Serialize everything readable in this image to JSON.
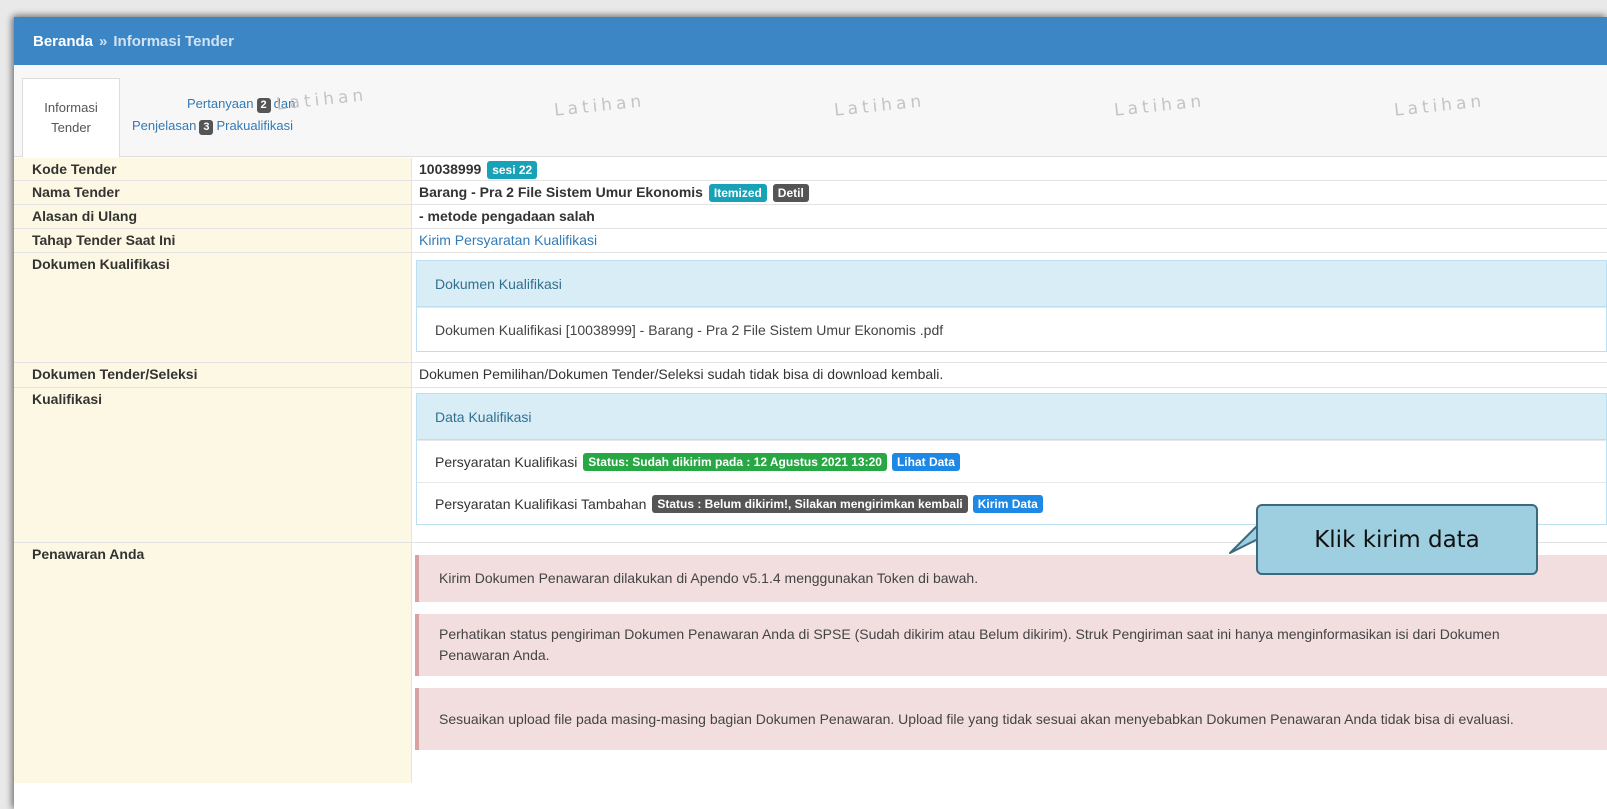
{
  "breadcrumb": {
    "home": "Beranda",
    "separator": "»",
    "current": "Informasi Tender"
  },
  "tabs": {
    "active": {
      "line1": "Informasi",
      "line2": "Tender"
    },
    "second": {
      "part1": "Pertanyaan",
      "badge1": "2",
      "part2": "dan",
      "part3": "Penjelasan",
      "badge2": "3",
      "part4": "Prakualifikasi"
    }
  },
  "watermark": "Latihan",
  "fields": {
    "kode": {
      "label": "Kode Tender",
      "value": "10038999",
      "badge": "sesi 22"
    },
    "nama": {
      "label": "Nama Tender",
      "value": "Barang - Pra 2 File Sistem Umur Ekonomis",
      "badge1": "Itemized",
      "badge2": "Detil"
    },
    "alasan": {
      "label": "Alasan di Ulang",
      "value": "- metode pengadaan salah"
    },
    "tahap": {
      "label": "Tahap Tender Saat Ini",
      "value": "Kirim Persyaratan Kualifikasi"
    },
    "dokumen_kualifikasi": {
      "label": "Dokumen Kualifikasi",
      "panel_title": "Dokumen Kualifikasi",
      "file": "Dokumen Kualifikasi [10038999] - Barang - Pra 2 File Sistem Umur Ekonomis .pdf"
    },
    "dokumen_tender": {
      "label": "Dokumen Tender/Seleksi",
      "value": "Dokumen Pemilihan/Dokumen Tender/Seleksi sudah tidak bisa di download kembali."
    },
    "kualifikasi": {
      "label": "Kualifikasi",
      "panel_title": "Data Kualifikasi",
      "row1": {
        "text": "Persyaratan Kualifikasi",
        "status": "Status: Sudah dikirim pada : 12 Agustus 2021 13:20",
        "action": "Lihat Data"
      },
      "row2": {
        "text": "Persyaratan Kualifikasi Tambahan",
        "status": "Status : Belum dikirim!, Silakan mengirimkan kembali",
        "action": "Kirim Data"
      }
    },
    "penawaran": {
      "label": "Penawaran Anda",
      "alerts": [
        "Kirim Dokumen Penawaran dilakukan di Apendo v5.1.4 menggunakan Token di bawah.",
        "Perhatikan status pengiriman Dokumen Penawaran Anda di SPSE (Sudah dikirim atau Belum dikirim). Struk Pengiriman saat ini hanya menginformasikan isi dari Dokumen Penawaran Anda.",
        "Sesuaikan upload file pada masing-masing bagian Dokumen Penawaran. Upload file yang tidak sesuai akan menyebabkan Dokumen Penawaran Anda tidak bisa di evaluasi."
      ]
    }
  },
  "callout": "Klik kirim data",
  "colors": {
    "header": "#3d86c6",
    "label_bg": "#fcf8e3",
    "panel_head": "#d9edf7",
    "alert_bg": "#f2dede",
    "callout_bg": "#9dcfe0"
  }
}
